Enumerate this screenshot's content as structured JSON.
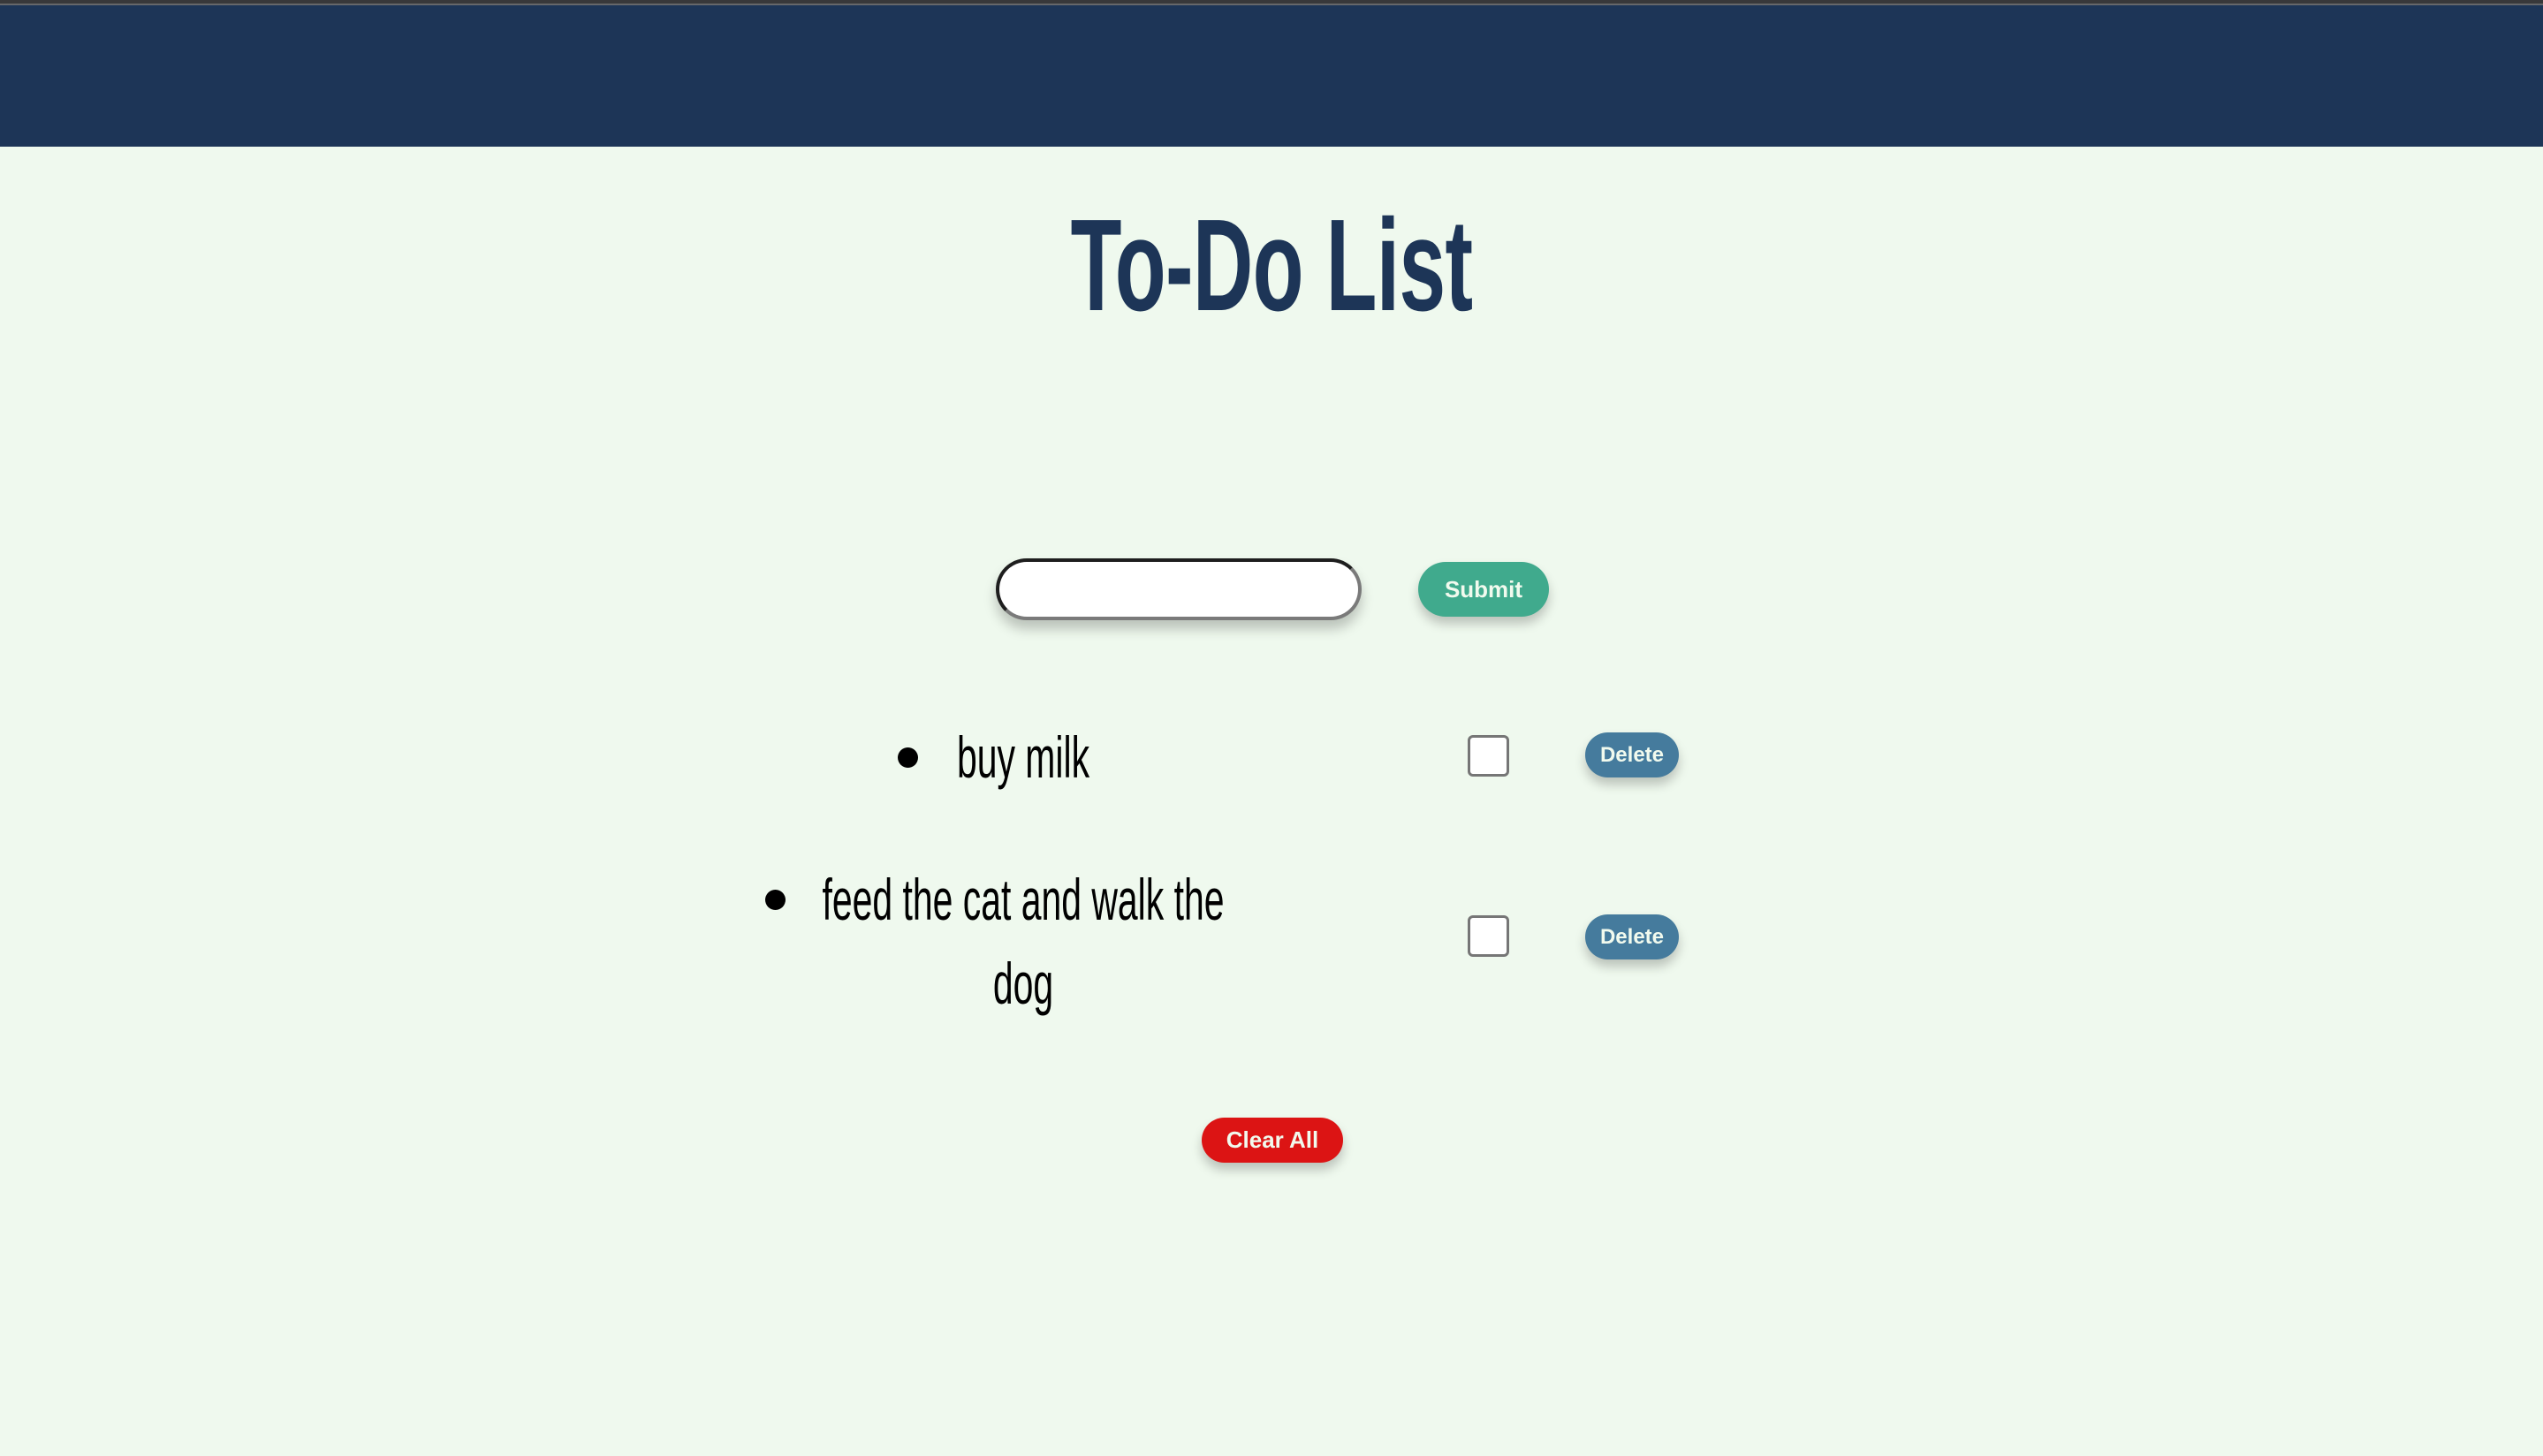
{
  "header": {
    "background_color": "#1d3557"
  },
  "page": {
    "title": "To-Do List",
    "background_color": "#eff9ee",
    "title_color": "#1d3557"
  },
  "form": {
    "input_value": "",
    "input_placeholder": "",
    "submit_label": "Submit",
    "submit_color": "#40aa8d"
  },
  "todos": [
    {
      "text": "buy milk",
      "checked": false,
      "delete_label": "Delete"
    },
    {
      "text": "feed the cat and walk the dog",
      "checked": false,
      "delete_label": "Delete"
    }
  ],
  "colors": {
    "delete_button": "#457b9d",
    "clear_all_button": "#dc1414",
    "button_text": "#f1faee"
  },
  "actions": {
    "clear_all_label": "Clear All"
  }
}
